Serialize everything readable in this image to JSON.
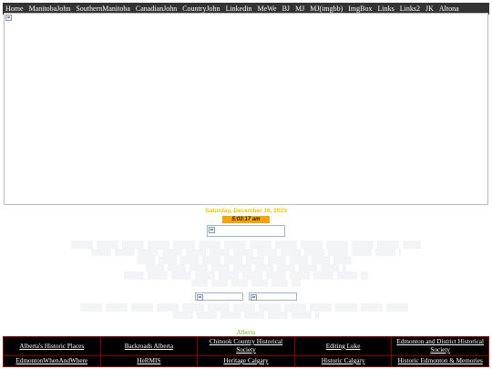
{
  "nav": {
    "items": [
      "Home",
      "ManitobaJohn",
      "SouthernManitoba",
      "CanadianJohn",
      "CountryJohn",
      "Linkedin",
      "MeWe",
      "BJ",
      "MJ",
      "MJ(imgbb)",
      "ImgBox",
      "Links",
      "Links2",
      "JK",
      "Altona"
    ]
  },
  "date_text": "Saturday, December 16, 2023",
  "clock_text": "5:03:17 am",
  "region_title": "Alberta",
  "links_table": {
    "row1": [
      "Alberta's Historic Places",
      "Backroads Alberta",
      "Chinook Country Historical Society",
      "Editing Luke",
      "Edmonton and District Historical Society"
    ],
    "row2": [
      "EdmontonWhenAndWhere",
      "HeRMIS",
      "Heritage Calgary",
      "Historic Calgary",
      "Historic Edmonton & Memories"
    ]
  },
  "colors": {
    "nav_bg": "#333333",
    "date": "#e8c70a",
    "clock_bg": "#f5a30a",
    "region_title": "#6ec21f",
    "table_bg": "#000000",
    "table_border": "#8b0000"
  }
}
